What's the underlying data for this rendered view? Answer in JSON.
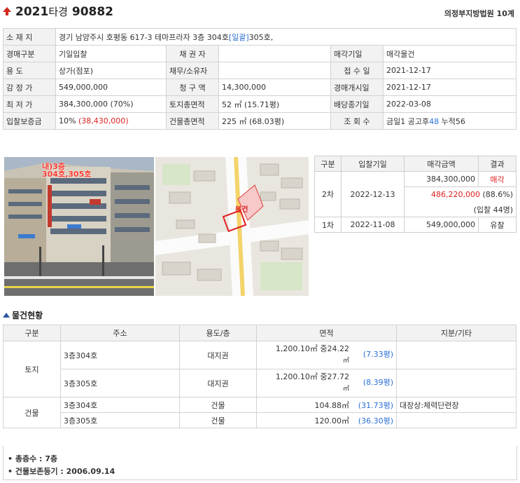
{
  "header": {
    "year": "2021",
    "kind": "타경",
    "number": "90882",
    "court": "의정부지방법원 10계"
  },
  "info": {
    "address_label": "소 재 지",
    "address": "경기 남양주시 호평동 617-3 테마프라자 3층 304호",
    "address_link": "[일괄]",
    "address_extra": "305호,",
    "type_label": "경매구분",
    "type": "기일입찰",
    "creditor_label": "채 권 자",
    "creditor": "",
    "sale_obj_label": "매각기일",
    "sale_obj": "매각물건",
    "usage_label": "용 도",
    "usage": "상가(점포)",
    "debtor_label": "채무/소유자",
    "debtor": "",
    "received_label": "접 수 일",
    "received": "2021-12-17",
    "appraisal_label": "감 정 가",
    "appraisal": "549,000,000",
    "claim_label": "청 구 액",
    "claim": "14,300,000",
    "start_label": "경매개시일",
    "start": "2021-12-17",
    "min_label": "최 저 가",
    "min": "384,300,000 (70%)",
    "land_area_label": "토지총면적",
    "land_area": "52 ㎡ (15.71평)",
    "dividend_label": "배당종기일",
    "dividend": "2022-03-08",
    "deposit_label": "입찰보증금",
    "deposit_pct": "10%",
    "deposit_amt": "(38,430,000)",
    "bldg_area_label": "건물총면적",
    "bldg_area": "225 ㎡ (68.03평)",
    "views_label": "조 회 수",
    "views_prefix": "금일1 공고후",
    "views_highlight": "48",
    "views_suffix": " 누적56"
  },
  "photo": {
    "overlay1": "내)3층",
    "overlay2": "304호,305호"
  },
  "map": {
    "marker": "본건"
  },
  "bids": {
    "headers": [
      "구분",
      "입찰기일",
      "매각금액",
      "결과"
    ],
    "row2_label": "2차",
    "row2_date": "2022-12-13",
    "row2_min": "384,300,000",
    "row2_result": "매각",
    "row2_sold": "486,220,000",
    "row2_pct": " (88.6%)",
    "row2_bidders": "(입찰 44명)",
    "row1_label": "1차",
    "row1_date": "2022-11-08",
    "row1_price": "549,000,000",
    "row1_result": "유찰"
  },
  "goods": {
    "section_title": "물건현황",
    "headers": [
      "구분",
      "주소",
      "용도/층",
      "면적",
      "지분/기타"
    ],
    "land_label": "토지",
    "bldg_label": "건물",
    "r1_addr": "3층304호",
    "r1_use": "대지권",
    "r1_area": "1,200.10㎡ 중24.22",
    "r1_unit": "㎡",
    "r1_py": "(7.33평)",
    "r2_addr": "3층305호",
    "r2_use": "대지권",
    "r2_area": "1,200.10㎡ 중27.72",
    "r2_unit": "㎡",
    "r2_py": "(8.39평)",
    "r3_addr": "3층304호",
    "r3_use": "건물",
    "r3_area": "104.88㎡",
    "r3_py": "(31.73평)",
    "r3_etc": "대장상:체력단련장",
    "r4_addr": "3층305호",
    "r4_use": "건물",
    "r4_area": "120.00㎡",
    "r4_py": "(36.30평)"
  },
  "footer": {
    "floors": "• 총층수 : 7층",
    "reg": "• 건물보존등기 : 2006.09.14"
  }
}
